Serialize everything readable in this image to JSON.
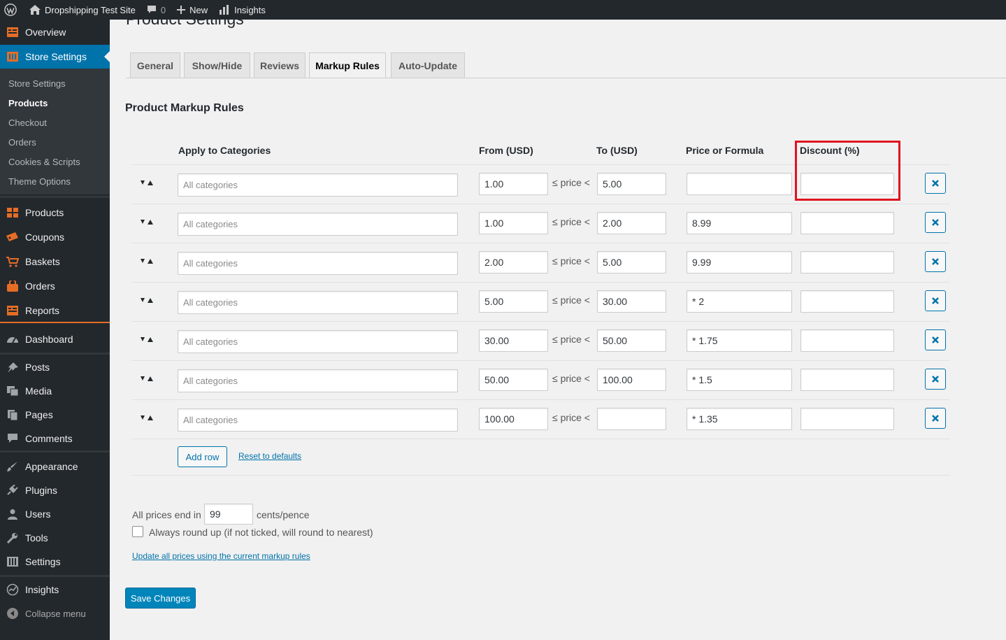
{
  "admin_bar": {
    "site_name": "Dropshipping Test Site",
    "comments_count": "0",
    "new_label": "New",
    "insights_label": "Insights"
  },
  "sidebar": {
    "top_items": [
      {
        "label": "Overview",
        "icon": "overview-icon"
      },
      {
        "label": "Store Settings",
        "icon": "store-settings-icon"
      }
    ],
    "submenu": [
      "Store Settings",
      "Products",
      "Checkout",
      "Orders",
      "Cookies & Scripts",
      "Theme Options"
    ],
    "submenu_current": "Products",
    "store_items": [
      {
        "label": "Products",
        "icon": "products-icon"
      },
      {
        "label": "Coupons",
        "icon": "coupons-icon"
      },
      {
        "label": "Baskets",
        "icon": "basket-icon"
      },
      {
        "label": "Orders",
        "icon": "orders-icon"
      },
      {
        "label": "Reports",
        "icon": "reports-icon"
      }
    ],
    "dashboard": "Dashboard",
    "wp_items": [
      {
        "label": "Posts",
        "icon": "pin-icon"
      },
      {
        "label": "Media",
        "icon": "media-icon"
      },
      {
        "label": "Pages",
        "icon": "pages-icon"
      },
      {
        "label": "Comments",
        "icon": "comment-icon"
      }
    ],
    "admin_items": [
      {
        "label": "Appearance",
        "icon": "brush-icon"
      },
      {
        "label": "Plugins",
        "icon": "plugin-icon"
      },
      {
        "label": "Users",
        "icon": "user-icon"
      },
      {
        "label": "Tools",
        "icon": "wrench-icon"
      },
      {
        "label": "Settings",
        "icon": "settings-icon"
      }
    ],
    "insights": "Insights",
    "collapse": "Collapse menu"
  },
  "page": {
    "title": "Product Settings",
    "tabs": [
      "General",
      "Show/Hide",
      "Reviews",
      "Markup Rules",
      "Auto-Update"
    ],
    "active_tab": "Markup Rules",
    "section_title": "Product Markup Rules"
  },
  "table": {
    "headers": {
      "categories": "Apply to Categories",
      "from": "From (USD)",
      "to": "To (USD)",
      "price": "Price or Formula",
      "discount": "Discount (%)"
    },
    "category_placeholder": "All categories",
    "price_label": "≤ price <",
    "rows": [
      {
        "from": "1.00",
        "to": "5.00",
        "price": "",
        "discount": ""
      },
      {
        "from": "1.00",
        "to": "2.00",
        "price": "8.99",
        "discount": ""
      },
      {
        "from": "2.00",
        "to": "5.00",
        "price": "9.99",
        "discount": ""
      },
      {
        "from": "5.00",
        "to": "30.00",
        "price": "* 2",
        "discount": ""
      },
      {
        "from": "30.00",
        "to": "50.00",
        "price": "* 1.75",
        "discount": ""
      },
      {
        "from": "50.00",
        "to": "100.00",
        "price": "* 1.5",
        "discount": ""
      },
      {
        "from": "100.00",
        "to": "",
        "price": "* 1.35",
        "discount": ""
      }
    ],
    "add_row": "Add row",
    "reset": "Reset to defaults"
  },
  "options": {
    "prices_end_prefix": "All prices end in",
    "cents_value": "99",
    "prices_end_suffix": "cents/pence",
    "round_up_label": "Always round up (if not ticked, will round to nearest)",
    "update_link": "Update all prices using the current markup rules"
  },
  "save_button": "Save Changes",
  "colors": {
    "admin_dark": "#23282d",
    "accent": "#0073aa",
    "primary": "#0085ba",
    "highlight": "#e0141f",
    "separator": "#e56d26"
  }
}
